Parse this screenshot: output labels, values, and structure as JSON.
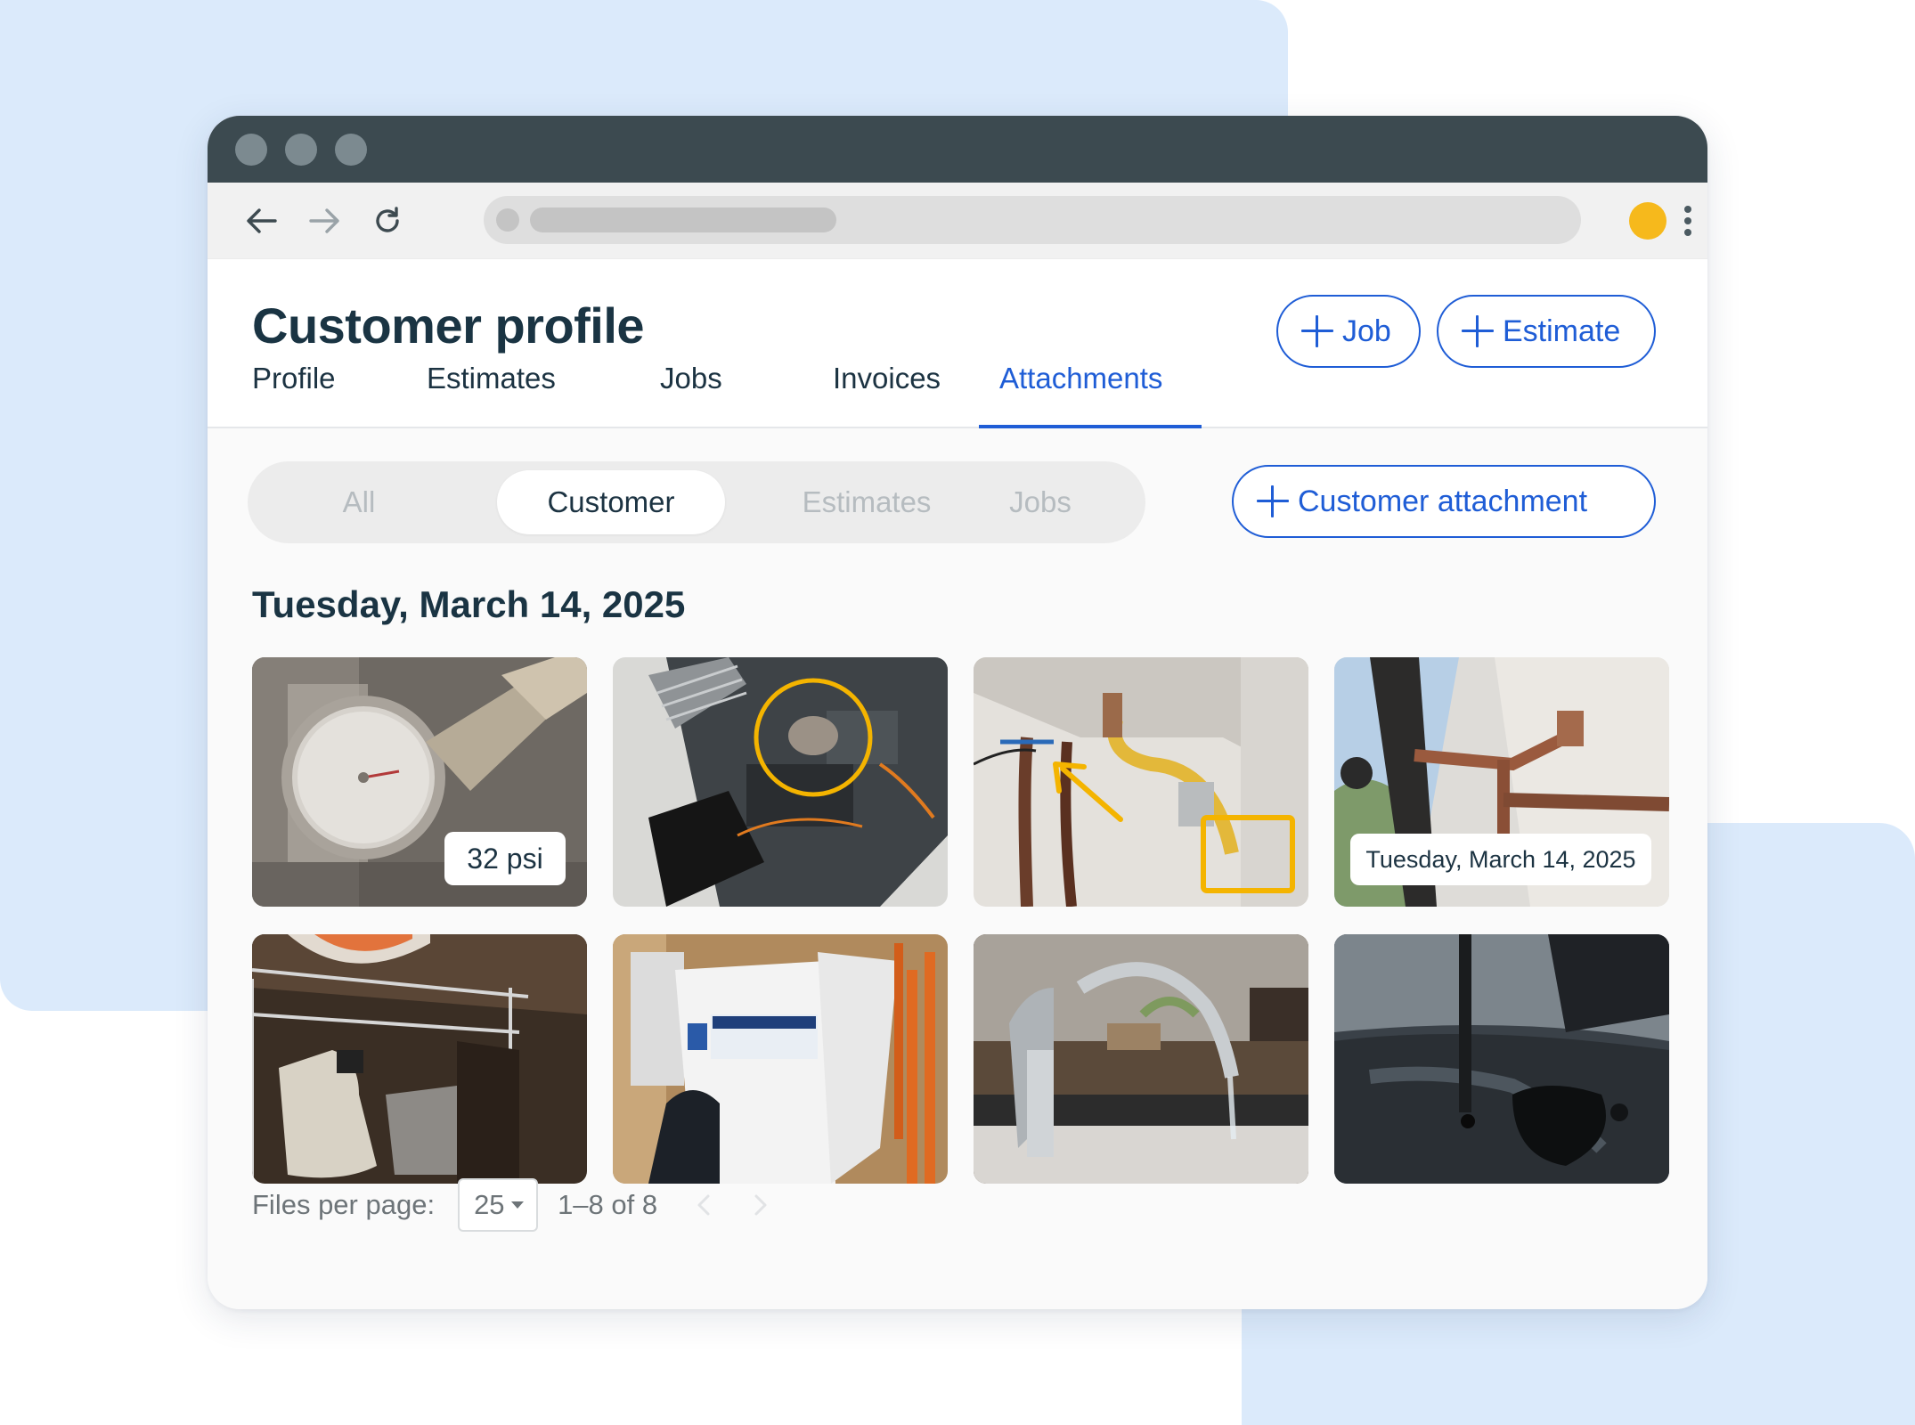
{
  "page": {
    "title": "Customer profile",
    "buttons": {
      "job": "Job",
      "estimate": "Estimate",
      "customer_attachment": "Customer attachment"
    }
  },
  "tabs": [
    {
      "label": "Profile",
      "active": false
    },
    {
      "label": "Estimates",
      "active": false
    },
    {
      "label": "Jobs",
      "active": false
    },
    {
      "label": "Invoices",
      "active": false
    },
    {
      "label": "Attachments",
      "active": true
    }
  ],
  "filters": {
    "options": [
      {
        "label": "All",
        "selected": false
      },
      {
        "label": "Customer",
        "selected": true
      },
      {
        "label": "Estimates",
        "selected": false
      },
      {
        "label": "Jobs",
        "selected": false
      }
    ]
  },
  "attachments": {
    "date_heading": "Tuesday, March 14, 2025",
    "thumbnails": [
      {
        "subject": "pressure-gauge",
        "badge": "32 psi"
      },
      {
        "subject": "hvac-unit-annotated"
      },
      {
        "subject": "pipes-annotated"
      },
      {
        "subject": "outdoor-spigot",
        "badge": "Tuesday, March 14, 2025"
      },
      {
        "subject": "cleaner-under-sink"
      },
      {
        "subject": "water-heater-box"
      },
      {
        "subject": "kitchen-faucet"
      },
      {
        "subject": "asphalt-drilling"
      }
    ]
  },
  "pagination": {
    "label": "Files per page:",
    "per_page": "25",
    "range": "1–8 of 8"
  },
  "colors": {
    "accent": "#1f5dd6",
    "annotation": "#f4b400",
    "titlebar": "#3c4a50",
    "background_shape": "#dbeafb",
    "profile_dot": "#f6b91c"
  },
  "icons": [
    "back-arrow-icon",
    "forward-arrow-icon",
    "reload-icon",
    "plus-icon",
    "menu-kebab-icon",
    "caret-down-icon",
    "chevron-left-icon",
    "chevron-right-icon"
  ]
}
